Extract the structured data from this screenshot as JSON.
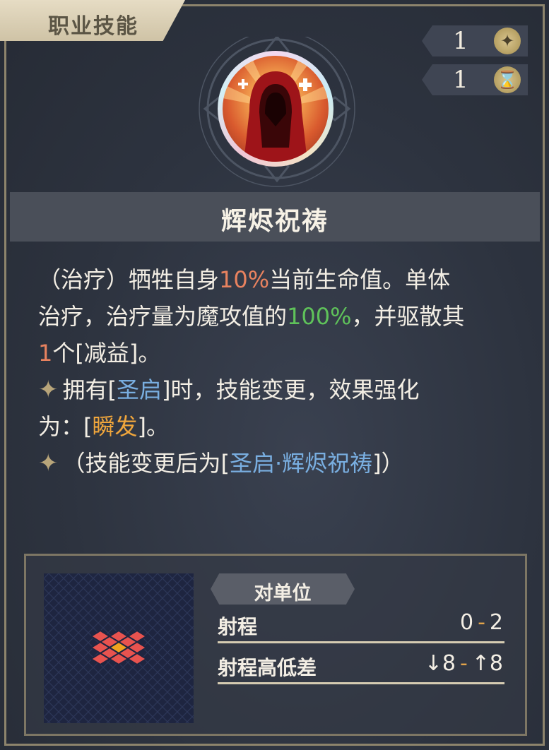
{
  "header": {
    "tab_label": "职业技能"
  },
  "counters": [
    {
      "value": "1",
      "icon": "star-sparkle-icon"
    },
    {
      "value": "1",
      "icon": "hourglass-icon"
    }
  ],
  "skill": {
    "name": "辉烬祝祷",
    "icon": "hooded-figure-heal-icon"
  },
  "description": {
    "l1_a": "（治疗）牺牲自身",
    "l1_b": "10%",
    "l1_c": "当前生命值。单体",
    "l2_a": "治疗，治疗量为魔攻值的",
    "l2_b": "100%",
    "l2_c": "，并驱散其",
    "l3_a": "1",
    "l3_b": "个[减益]。",
    "l4_a": "拥有[",
    "l4_b": "圣启",
    "l4_c": "]时，技能变更，效果强化",
    "l5_a": "为：[",
    "l5_b": "瞬发",
    "l5_c": "]。",
    "l6_a": "（技能变更后为[",
    "l6_b": "圣启·辉烬祝祷",
    "l6_c": "]）"
  },
  "stats": {
    "target": "对单位",
    "range_label": "射程",
    "range_min": "0",
    "range_max": "2",
    "height_label": "射程高低差",
    "height_down": "8",
    "height_up": "8"
  },
  "colors": {
    "highlight_red": "#e8825f",
    "highlight_green": "#5fc25a",
    "highlight_blue": "#79aee0",
    "highlight_orange": "#f0a63c",
    "tile_red": "#e8534f",
    "tile_center": "#f0a21f"
  }
}
